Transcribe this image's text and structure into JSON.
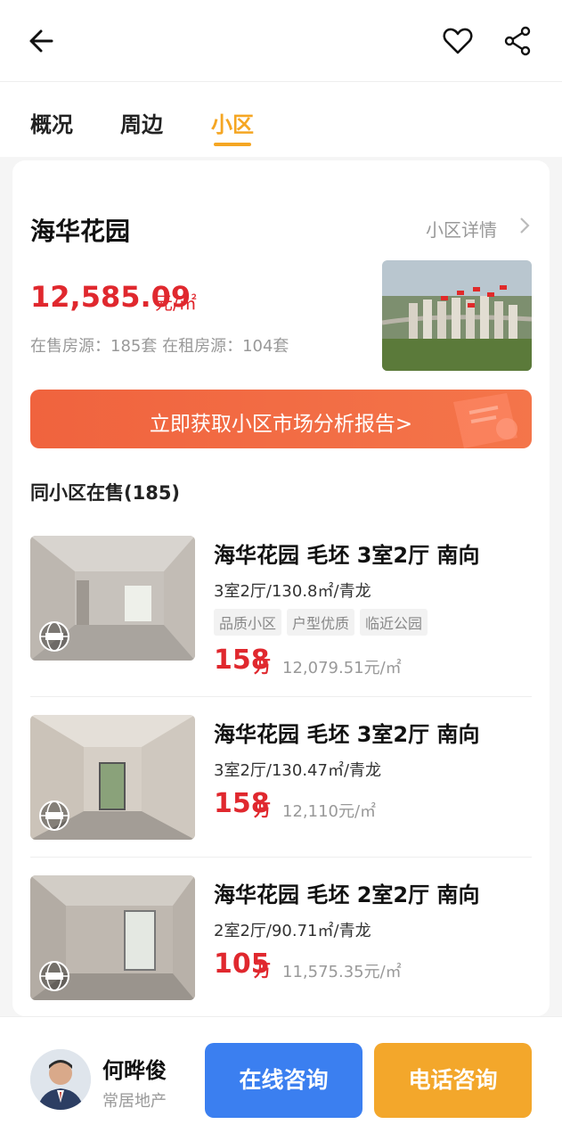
{
  "tabs": [
    {
      "label": "概况"
    },
    {
      "label": "周边"
    },
    {
      "label": "小区"
    }
  ],
  "active_tab": "小区",
  "community": {
    "name": "海华花园",
    "detail_link": "小区详情",
    "price": "12,585.09",
    "price_unit": "元/㎡",
    "stock_text": "在售房源：185套    在租房源：104套"
  },
  "report_button": "立即获取小区市场分析报告>",
  "section_title": "同小区在售(185)",
  "listings": [
    {
      "title": "海华花园 毛坯 3室2厅 南向",
      "spec": "3室2厅/130.8㎡/青龙",
      "tags": [
        "品质小区",
        "户型优质",
        "临近公园"
      ],
      "price": "158",
      "price_unit": "万",
      "unit_price": "12,079.51元/㎡"
    },
    {
      "title": "海华花园 毛坯 3室2厅 南向",
      "spec": "3室2厅/130.47㎡/青龙",
      "tags": [],
      "price": "158",
      "price_unit": "万",
      "unit_price": "12,110元/㎡"
    },
    {
      "title": "海华花园 毛坯 2室2厅 南向",
      "spec": "2室2厅/90.71㎡/青龙",
      "tags": [],
      "price": "105",
      "price_unit": "万",
      "unit_price": "11,575.35元/㎡"
    }
  ],
  "agent": {
    "name": "何晔俊",
    "company": "常居地产"
  },
  "actions": {
    "online": "在线咨询",
    "phone": "电话咨询"
  },
  "colors": {
    "accent": "#f5a623",
    "price_red": "#e0282e",
    "online_blue": "#3b7ff0",
    "phone_orange": "#f3a72b",
    "report_orange": "#f0633e"
  },
  "icons": {
    "back": "arrow-left-icon",
    "favorite": "heart-icon",
    "share": "share-icon",
    "vr": "vr-globe-icon",
    "chevron": "chevron-right-icon"
  }
}
